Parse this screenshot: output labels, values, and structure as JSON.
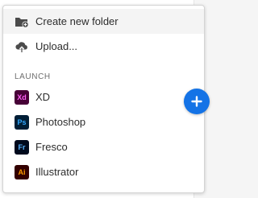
{
  "menu": {
    "items": [
      {
        "label": "Create new folder",
        "icon": "folder-add-icon"
      },
      {
        "label": "Upload...",
        "icon": "cloud-upload-icon"
      }
    ],
    "section_heading": "LAUNCH",
    "apps": [
      {
        "label": "XD",
        "icon_text": "Xd",
        "bg": "#470137",
        "fg": "#ff61f6"
      },
      {
        "label": "Photoshop",
        "icon_text": "Ps",
        "bg": "#001e36",
        "fg": "#31a8ff"
      },
      {
        "label": "Fresco",
        "icon_text": "Fr",
        "bg": "#000a1d",
        "fg": "#5ab4ff"
      },
      {
        "label": "Illustrator",
        "icon_text": "Ai",
        "bg": "#330000",
        "fg": "#ff9a00"
      }
    ]
  },
  "fab": {
    "icon": "plus-icon",
    "color": "#1473e6"
  }
}
